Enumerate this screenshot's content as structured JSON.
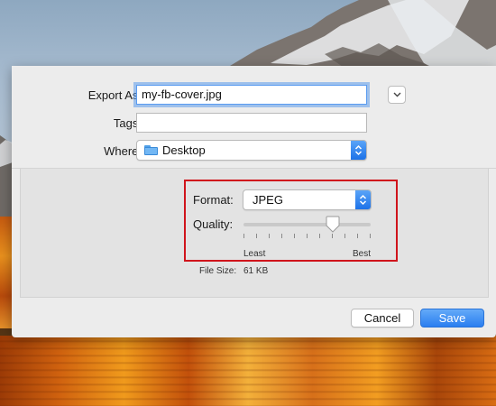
{
  "dialog": {
    "export_as_label": "Export As:",
    "export_as_value": "my-fb-cover.jpg",
    "tags_label": "Tags:",
    "tags_value": "",
    "where_label": "Where:",
    "where_value": "Desktop",
    "where_icon": "folder-icon",
    "expand_icon": "chevron-down-icon"
  },
  "options": {
    "format_label": "Format:",
    "format_value": "JPEG",
    "quality_label": "Quality:",
    "quality_level": 0.73,
    "quality_min_label": "Least",
    "quality_max_label": "Best",
    "file_size_label": "File Size:",
    "file_size_value": "61 KB"
  },
  "buttons": {
    "cancel_label": "Cancel",
    "save_label": "Save"
  },
  "colors": {
    "accent": "#2a7ef0",
    "highlight_box": "#d0141c"
  }
}
